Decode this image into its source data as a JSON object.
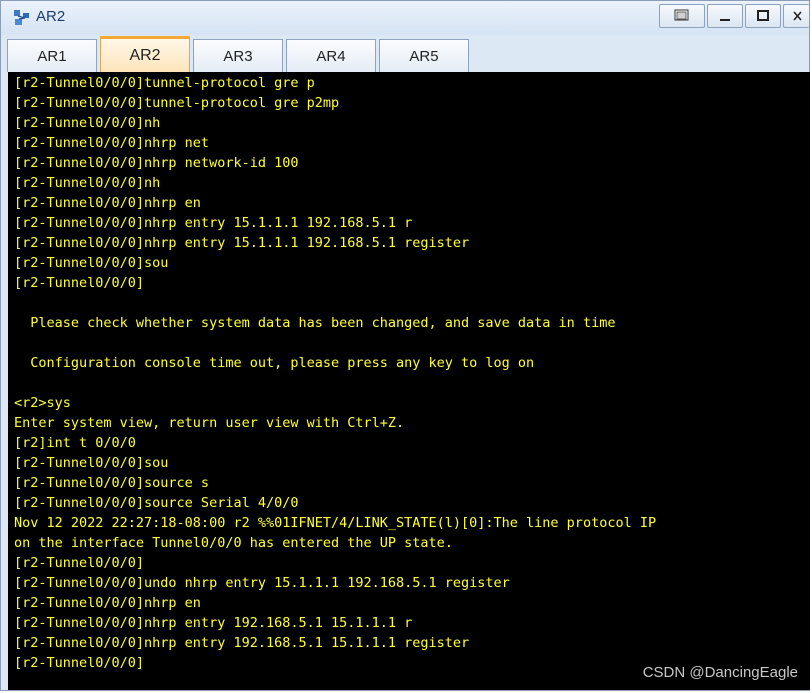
{
  "window": {
    "title": "AR2",
    "buttons": [
      "restore-view",
      "minimize",
      "maximize",
      "close"
    ]
  },
  "tabs": [
    "AR1",
    "AR2",
    "AR3",
    "AR4",
    "AR5"
  ],
  "active_tab": "AR2",
  "terminal": {
    "text_color": "#ffff3a",
    "background": "#000000",
    "lines": [
      "[r2-Tunnel0/0/0]tunnel-protocol gre p",
      "[r2-Tunnel0/0/0]tunnel-protocol gre p2mp",
      "[r2-Tunnel0/0/0]nh",
      "[r2-Tunnel0/0/0]nhrp net",
      "[r2-Tunnel0/0/0]nhrp network-id 100",
      "[r2-Tunnel0/0/0]nh",
      "[r2-Tunnel0/0/0]nhrp en",
      "[r2-Tunnel0/0/0]nhrp entry 15.1.1.1 192.168.5.1 r",
      "[r2-Tunnel0/0/0]nhrp entry 15.1.1.1 192.168.5.1 register",
      "[r2-Tunnel0/0/0]sou",
      "[r2-Tunnel0/0/0]",
      "",
      "  Please check whether system data has been changed, and save data in time",
      "",
      "  Configuration console time out, please press any key to log on",
      "",
      "<r2>sys",
      "Enter system view, return user view with Ctrl+Z.",
      "[r2]int t 0/0/0",
      "[r2-Tunnel0/0/0]sou",
      "[r2-Tunnel0/0/0]source s",
      "[r2-Tunnel0/0/0]source Serial 4/0/0",
      "Nov 12 2022 22:27:18-08:00 r2 %%01IFNET/4/LINK_STATE(l)[0]:The line protocol IP",
      "on the interface Tunnel0/0/0 has entered the UP state.",
      "[r2-Tunnel0/0/0]",
      "[r2-Tunnel0/0/0]undo nhrp entry 15.1.1.1 192.168.5.1 register",
      "[r2-Tunnel0/0/0]nhrp en",
      "[r2-Tunnel0/0/0]nhrp entry 192.168.5.1 15.1.1.1 r",
      "[r2-Tunnel0/0/0]nhrp entry 192.168.5.1 15.1.1.1 register",
      "[r2-Tunnel0/0/0]"
    ]
  },
  "watermark": "CSDN @DancingEagle"
}
